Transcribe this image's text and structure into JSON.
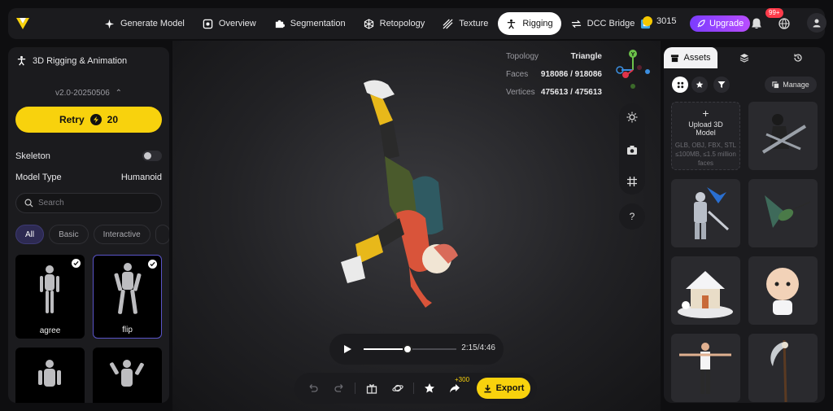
{
  "nav": {
    "items": [
      {
        "label": "Generate Model",
        "icon": "sparkle-icon"
      },
      {
        "label": "Overview",
        "icon": "overview-icon"
      },
      {
        "label": "Segmentation",
        "icon": "puzzle-icon"
      },
      {
        "label": "Retopology",
        "icon": "mesh-icon"
      },
      {
        "label": "Texture",
        "icon": "texture-icon"
      },
      {
        "label": "Rigging",
        "icon": "person-icon"
      },
      {
        "label": "DCC Bridge",
        "icon": "bridge-icon"
      }
    ],
    "active": "Rigging"
  },
  "header": {
    "credits": "3015",
    "upgrade_label": "Upgrade",
    "notification_badge": "99+"
  },
  "left": {
    "title": "3D Rigging & Animation",
    "version": "v2.0-20250506",
    "retry_label": "Retry",
    "retry_cost": "20",
    "skeleton_label": "Skeleton",
    "model_type_label": "Model Type",
    "model_type_value": "Humanoid",
    "search_placeholder": "Search",
    "filters": [
      "All",
      "Basic",
      "Interactive"
    ],
    "animations": [
      {
        "label": "agree",
        "checked": true,
        "selected": false
      },
      {
        "label": "flip",
        "checked": true,
        "selected": true
      },
      {
        "label": "",
        "checked": false,
        "selected": false
      },
      {
        "label": "",
        "checked": false,
        "selected": false
      }
    ]
  },
  "viewport": {
    "topology_label": "Topology",
    "topology_value": "Triangle",
    "faces_label": "Faces",
    "faces_value": "918086 / 918086",
    "vertices_label": "Vertices",
    "vertices_value": "475613 / 475613",
    "gizmo_y": "Y",
    "help_label": "?",
    "time": "2:15/4:46",
    "progress_fraction": 0.47,
    "export_label": "Export",
    "export_bonus": "+300"
  },
  "right": {
    "tabs": [
      "Assets",
      "",
      ""
    ],
    "manage_label": "Manage",
    "upload_title": "Upload 3D Model",
    "upload_formats": "GLB, OBJ, FBX, STL ≤100MB, ≤1.5 million faces"
  },
  "colors": {
    "accent": "#f8d20d",
    "upgrade": "#9b45ff",
    "selected_border": "#5a54c8"
  }
}
